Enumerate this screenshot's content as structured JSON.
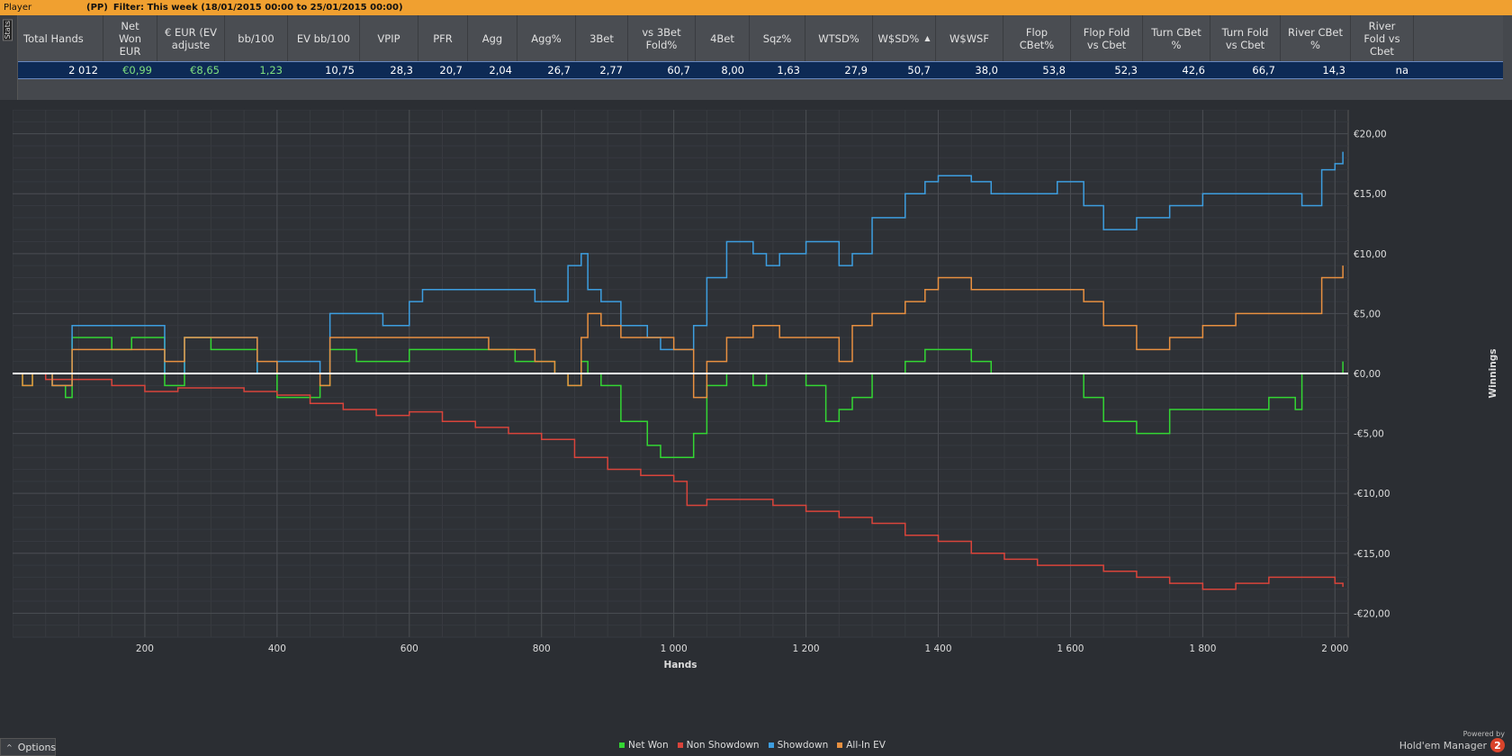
{
  "topbar": {
    "player": "Player",
    "pp": "(PP)",
    "filter": "Filter: This week (18/01/2015 00:00 to 25/01/2015 00:00)"
  },
  "stats_tab_label": "Stats",
  "stats_table": {
    "columns": [
      {
        "label": "Total Hands",
        "value": "2 012"
      },
      {
        "label": "Net Won EUR",
        "value": "€0,99"
      },
      {
        "label": "€ EUR (EV adjuste",
        "value": "€8,65"
      },
      {
        "label": "bb/100",
        "value": "1,23"
      },
      {
        "label": "EV bb/100",
        "value": "10,75"
      },
      {
        "label": "VPIP",
        "value": "28,3"
      },
      {
        "label": "PFR",
        "value": "20,7"
      },
      {
        "label": "Agg",
        "value": "2,04"
      },
      {
        "label": "Agg%",
        "value": "26,7"
      },
      {
        "label": "3Bet",
        "value": "2,77"
      },
      {
        "label": "vs 3Bet Fold%",
        "value": "60,7"
      },
      {
        "label": "4Bet",
        "value": "8,00"
      },
      {
        "label": "Sqz%",
        "value": "1,63"
      },
      {
        "label": "WTSD%",
        "value": "27,9"
      },
      {
        "label": "W$SD%",
        "value": "50,7"
      },
      {
        "label": "W$WSF",
        "value": "38,0"
      },
      {
        "label": "Flop CBet%",
        "value": "53,8"
      },
      {
        "label": "Flop Fold vs Cbet",
        "value": "52,3"
      },
      {
        "label": "Turn CBet %",
        "value": "42,6"
      },
      {
        "label": "Turn Fold vs Cbet",
        "value": "66,7"
      },
      {
        "label": "River CBet %",
        "value": "14,3"
      },
      {
        "label": "River Fold vs Cbet",
        "value": "na"
      }
    ],
    "sort_icon": "sort-up-icon"
  },
  "chart_data": {
    "type": "line",
    "xlabel": "Hands",
    "ylabel": "Winnings",
    "x_ticks": [
      "200",
      "400",
      "600",
      "800",
      "1 000",
      "1 200",
      "1 400",
      "1 600",
      "1 800",
      "2 000"
    ],
    "y_ticks": [
      "€20,00",
      "€15,00",
      "€10,00",
      "€5,00",
      "€0,00",
      "-€5,00",
      "-€10,00",
      "-€15,00",
      "-€20,00"
    ],
    "xlim": [
      0,
      2020
    ],
    "ylim": [
      -22,
      22
    ],
    "series": [
      {
        "name": "Net Won",
        "color": "#33d633",
        "x": [
          0,
          15,
          30,
          60,
          80,
          90,
          120,
          150,
          180,
          200,
          230,
          260,
          300,
          330,
          370,
          400,
          430,
          465,
          480,
          520,
          560,
          600,
          640,
          680,
          720,
          760,
          790,
          820,
          840,
          860,
          870,
          890,
          920,
          960,
          980,
          1000,
          1030,
          1050,
          1080,
          1120,
          1140,
          1160,
          1200,
          1230,
          1250,
          1270,
          1300,
          1350,
          1380,
          1400,
          1430,
          1450,
          1480,
          1520,
          1580,
          1620,
          1650,
          1700,
          1750,
          1800,
          1850,
          1900,
          1940,
          1950,
          1980,
          2000,
          2012
        ],
        "y": [
          0,
          -1,
          0,
          -1,
          -2,
          3,
          3,
          2,
          3,
          3,
          -1,
          3,
          2,
          2,
          0,
          -2,
          -2,
          -1,
          2,
          1,
          1,
          2,
          2,
          2,
          2,
          1,
          1,
          0,
          -1,
          1,
          0,
          -1,
          -4,
          -6,
          -7,
          -7,
          -5,
          -1,
          0,
          -1,
          0,
          0,
          -1,
          -4,
          -3,
          -2,
          0,
          1,
          2,
          2,
          2,
          1,
          0,
          0,
          0,
          -2,
          -4,
          -5,
          -3,
          -3,
          -3,
          -2,
          -3,
          0,
          0,
          0,
          1
        ]
      },
      {
        "name": "Non Showdown",
        "color": "#d9443b",
        "x": [
          0,
          50,
          100,
          150,
          200,
          250,
          300,
          350,
          400,
          450,
          500,
          550,
          600,
          650,
          700,
          750,
          800,
          850,
          900,
          950,
          1000,
          1020,
          1050,
          1100,
          1150,
          1200,
          1250,
          1300,
          1350,
          1400,
          1450,
          1500,
          1550,
          1600,
          1650,
          1700,
          1750,
          1800,
          1850,
          1900,
          1950,
          2000,
          2012
        ],
        "y": [
          0,
          -0.5,
          -0.5,
          -1,
          -1.5,
          -1.2,
          -1.2,
          -1.5,
          -1.8,
          -2.5,
          -3,
          -3.5,
          -3.2,
          -4,
          -4.5,
          -5,
          -5.5,
          -7,
          -8,
          -8.5,
          -9,
          -11,
          -10.5,
          -10.5,
          -11,
          -11.5,
          -12,
          -12.5,
          -13.5,
          -14,
          -15,
          -15.5,
          -16,
          -16,
          -16.5,
          -17,
          -17.5,
          -18,
          -17.5,
          -17,
          -17,
          -17.5,
          -17.8
        ]
      },
      {
        "name": "Showdown",
        "color": "#3d9ee0",
        "x": [
          0,
          15,
          30,
          60,
          80,
          90,
          120,
          150,
          180,
          200,
          230,
          260,
          300,
          330,
          370,
          400,
          430,
          465,
          480,
          520,
          560,
          600,
          620,
          640,
          680,
          720,
          760,
          790,
          820,
          840,
          860,
          870,
          890,
          920,
          960,
          980,
          1000,
          1030,
          1050,
          1080,
          1120,
          1140,
          1160,
          1200,
          1230,
          1250,
          1270,
          1300,
          1350,
          1380,
          1400,
          1430,
          1450,
          1480,
          1520,
          1580,
          1620,
          1650,
          1700,
          1750,
          1800,
          1850,
          1900,
          1940,
          1950,
          1980,
          2000,
          2012
        ],
        "y": [
          0,
          0,
          0,
          -1,
          -1,
          4,
          4,
          4,
          4,
          4,
          0,
          3,
          3,
          3,
          0,
          1,
          1,
          0,
          5,
          5,
          4,
          6,
          7,
          7,
          7,
          7,
          7,
          6,
          6,
          9,
          10,
          7,
          6,
          4,
          3,
          2,
          2,
          4,
          8,
          11,
          10,
          9,
          10,
          11,
          11,
          9,
          10,
          13,
          15,
          16,
          16.5,
          16.5,
          16,
          15,
          15,
          16,
          14,
          12,
          13,
          14,
          15,
          15,
          15,
          15,
          14,
          17,
          17.5,
          18.5
        ]
      },
      {
        "name": "All-In EV",
        "color": "#e89040",
        "x": [
          0,
          15,
          30,
          60,
          80,
          90,
          120,
          150,
          180,
          200,
          230,
          260,
          300,
          330,
          370,
          400,
          430,
          465,
          480,
          520,
          560,
          600,
          640,
          680,
          720,
          760,
          790,
          820,
          840,
          860,
          870,
          890,
          920,
          960,
          980,
          1000,
          1030,
          1050,
          1080,
          1120,
          1140,
          1160,
          1200,
          1230,
          1250,
          1270,
          1300,
          1350,
          1380,
          1400,
          1430,
          1450,
          1480,
          1520,
          1580,
          1620,
          1650,
          1700,
          1750,
          1800,
          1850,
          1900,
          1940,
          1950,
          1980,
          2000,
          2012
        ],
        "y": [
          0,
          -1,
          0,
          -1,
          -1,
          2,
          2,
          2,
          2,
          2,
          1,
          3,
          3,
          3,
          1,
          0,
          0,
          -1,
          3,
          3,
          3,
          3,
          3,
          3,
          2,
          2,
          1,
          0,
          -1,
          3,
          5,
          4,
          3,
          3,
          3,
          2,
          -2,
          1,
          3,
          4,
          4,
          3,
          3,
          3,
          1,
          4,
          5,
          6,
          7,
          8,
          8,
          7,
          7,
          7,
          7,
          6,
          4,
          2,
          3,
          4,
          5,
          5,
          5,
          5,
          8,
          8,
          9
        ]
      }
    ]
  },
  "options_label": "Options",
  "powered": {
    "line1": "Powered by",
    "line2": "Hold'em Manager",
    "logo": "2"
  }
}
